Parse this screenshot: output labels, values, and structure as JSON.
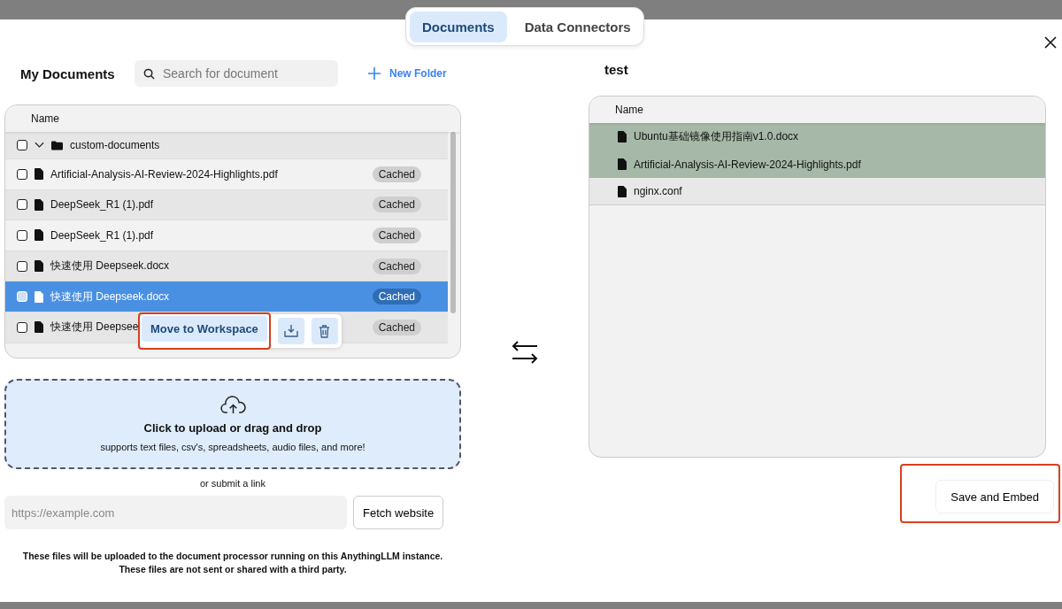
{
  "tabs": [
    {
      "label": "Documents",
      "selected": true
    },
    {
      "label": "Data Connectors",
      "selected": false
    }
  ],
  "my_documents": {
    "title": "My Documents",
    "search": {
      "placeholder": "Search for document"
    },
    "new_folder": "New Folder",
    "table": {
      "columns": [
        "Name"
      ],
      "folder": {
        "name": "custom-documents",
        "checked": false,
        "expanded": true
      },
      "rows": [
        {
          "name": "Artificial-Analysis-AI-Review-2024-Highlights.pdf",
          "badge": "Cached",
          "checked": false,
          "selected": false
        },
        {
          "name": "DeepSeek_R1 (1).pdf",
          "badge": "Cached",
          "checked": false,
          "selected": false
        },
        {
          "name": "DeepSeek_R1 (1).pdf",
          "badge": "Cached",
          "checked": false,
          "selected": false
        },
        {
          "name": "快速使用 Deepseek.docx",
          "badge": "Cached",
          "checked": false,
          "selected": false
        },
        {
          "name": "快速使用 Deepseek.docx",
          "badge": "Cached",
          "checked": false,
          "selected": true
        },
        {
          "name": "快速使用 Deepsee",
          "badge": "Cached",
          "checked": false,
          "selected": false
        }
      ]
    },
    "popup": {
      "button": "Move to Workspace",
      "highlighted": true
    }
  },
  "upload": {
    "title": "Click to upload or drag and drop",
    "subtitle": "supports text files, csv's, spreadsheets, audio files, and more!"
  },
  "link": {
    "label": "or submit a link",
    "placeholder": "https://example.com",
    "button": "Fetch website"
  },
  "notice": [
    "These files will be uploaded to the document processor running on this AnythingLLM instance.",
    "These files are not sent or shared with a third party."
  ],
  "workspace": {
    "title": "test",
    "table": {
      "columns": [
        "Name"
      ],
      "rows": [
        {
          "name": "Ubuntu基础镜像使用指南v1.0.docx",
          "pending": true
        },
        {
          "name": "Artificial-Analysis-AI-Review-2024-Highlights.pdf",
          "pending": true
        },
        {
          "name": "nginx.conf",
          "pending": false
        }
      ]
    },
    "save_button": {
      "label": "Save and Embed",
      "highlighted": true
    }
  }
}
